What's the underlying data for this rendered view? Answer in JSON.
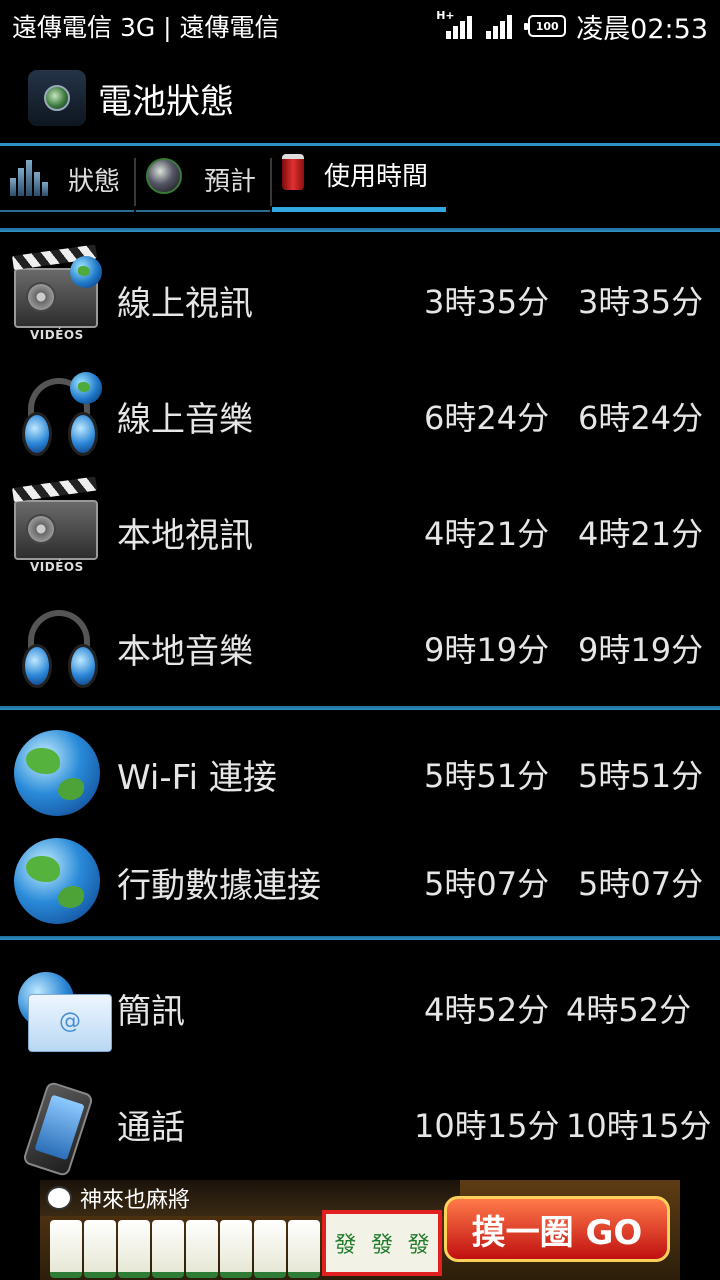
{
  "statusbar": {
    "carrier": "遠傳電信 3G | 遠傳電信",
    "network": "H+",
    "battery": "100",
    "time": "凌晨02:53"
  },
  "app": {
    "title": "電池狀態",
    "icon": "battery-disc-icon"
  },
  "tabs": [
    {
      "label": "狀態",
      "icon": "bar-chart-icon",
      "active": false
    },
    {
      "label": "預計",
      "icon": "disc-icon",
      "active": false
    },
    {
      "label": "使用時間",
      "icon": "battery-can-icon",
      "active": true
    }
  ],
  "usage": [
    {
      "name": "線上視訊",
      "v1": "3時35分",
      "v2": "3時35分",
      "icon": "video-globe-icon"
    },
    {
      "name": "線上音樂",
      "v1": "6時24分",
      "v2": "6時24分",
      "icon": "headphones-globe-icon"
    },
    {
      "name": "本地視訊",
      "v1": "4時21分",
      "v2": "4時21分",
      "icon": "video-icon"
    },
    {
      "name": "本地音樂",
      "v1": "9時19分",
      "v2": "9時19分",
      "icon": "headphones-icon"
    },
    {
      "name": "Wi-Fi 連接",
      "v1": "5時51分",
      "v2": "5時51分",
      "icon": "globe-icon"
    },
    {
      "name": "行動數據連接",
      "v1": "5時07分",
      "v2": "5時07分",
      "icon": "globe-icon"
    },
    {
      "name": "簡訊",
      "v1": "4時52分",
      "v2": "4時52分",
      "icon": "sms-icon"
    },
    {
      "name": "通話",
      "v1": "10時15分",
      "v2": "10時15分",
      "icon": "phone-icon"
    }
  ],
  "video_label": "VIDÉOS",
  "ad": {
    "title": "神來也麻將",
    "fa": [
      "發",
      "發",
      "發"
    ],
    "button": "摸一圈 GO"
  },
  "colors": {
    "accent": "#33a8e0",
    "divider": "#2f8fc4",
    "background": "#000000"
  }
}
